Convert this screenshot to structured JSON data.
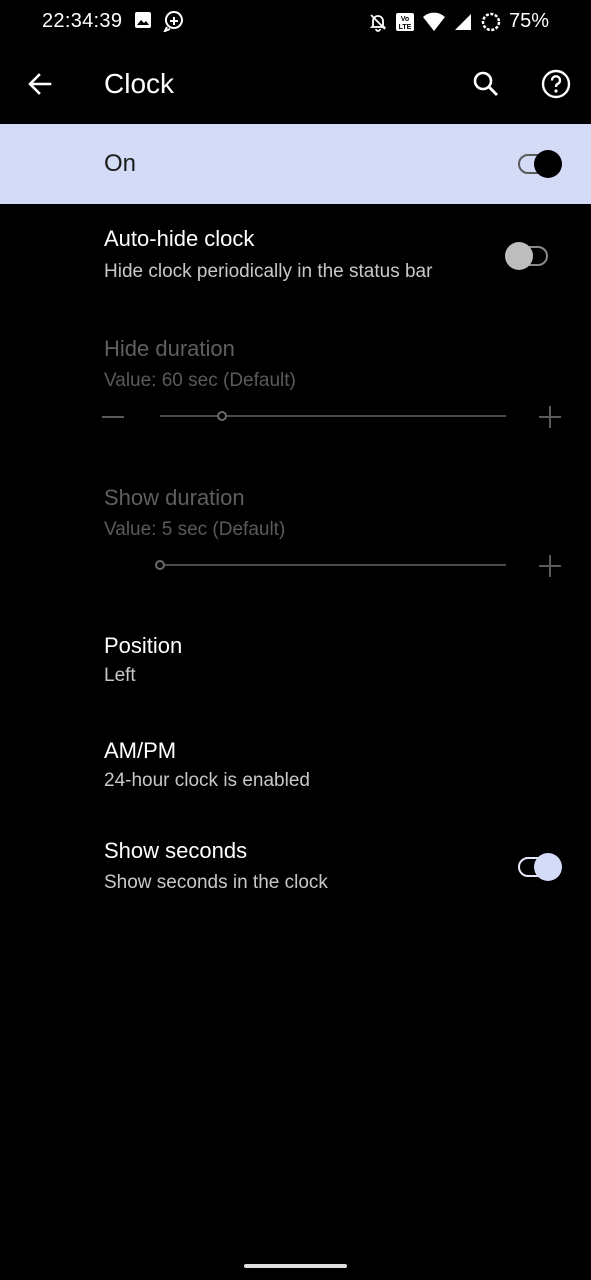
{
  "status_bar": {
    "time": "22:34:39",
    "battery_percent": "75%",
    "left_icons": [
      "image-icon",
      "location-plus-icon"
    ],
    "right_icons": [
      "notifications-off-icon",
      "volte-icon",
      "wifi-icon",
      "cell-signal-icon",
      "battery-saver-ring-icon"
    ],
    "volte_text": "Vo LTE"
  },
  "app_bar": {
    "title": "Clock",
    "back_icon": "arrow-back-icon",
    "search_icon": "search-icon",
    "help_icon": "help-circle-icon"
  },
  "master_switch": {
    "label": "On",
    "checked": true,
    "background": "#d3dbf7"
  },
  "preferences": {
    "auto_hide": {
      "title": "Auto-hide clock",
      "summary": "Hide clock periodically in the status bar",
      "checked": false
    },
    "hide_duration": {
      "title": "Hide duration",
      "summary": "Value: 60 sec (Default)",
      "enabled": false,
      "slider_fraction": 0.18
    },
    "show_duration": {
      "title": "Show duration",
      "summary": "Value: 5 sec (Default)",
      "enabled": false,
      "slider_fraction": 0.0
    },
    "position": {
      "title": "Position",
      "summary": "Left"
    },
    "ampm": {
      "title": "AM/PM",
      "summary": "24-hour clock is enabled"
    },
    "show_seconds": {
      "title": "Show seconds",
      "summary": "Show seconds in the clock",
      "checked": true
    }
  },
  "colors": {
    "accent": "#d3dbf7",
    "background": "#000000",
    "disabled_text": "#5f5f5f"
  }
}
